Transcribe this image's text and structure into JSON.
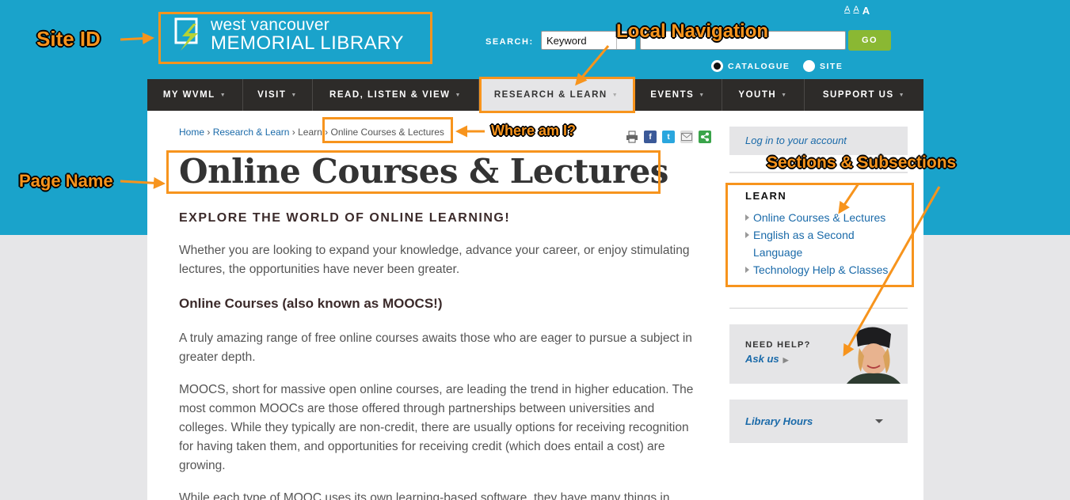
{
  "header": {
    "logo_line1": "west vancouver",
    "logo_line2": "MEMORIAL LIBRARY",
    "text_size": [
      "A",
      "A",
      "A"
    ],
    "search_label": "SEARCH:",
    "search_scope": "Keyword",
    "search_query": "",
    "go_label": "GO",
    "radio_catalogue": "CATALOGUE",
    "radio_site": "SITE"
  },
  "nav": [
    {
      "label": "MY WVML",
      "w": 0
    },
    {
      "label": "VISIT"
    },
    {
      "label": "READ, LISTEN & VIEW"
    },
    {
      "label": "RESEARCH & LEARN"
    },
    {
      "label": "EVENTS"
    },
    {
      "label": "YOUTH"
    },
    {
      "label": "SUPPORT US"
    }
  ],
  "breadcrumb": {
    "home": "Home",
    "sep1": "›",
    "research": "Research & Learn",
    "sep2": "›",
    "learn": "Learn",
    "sep3": "›",
    "current": "Online Courses & Lectures"
  },
  "main": {
    "title": "Online Courses & Lectures",
    "subhead": "EXPLORE THE WORLD OF ONLINE LEARNING!",
    "intro": "Whether you are looking to expand your knowledge, advance your career, or enjoy stimulating lectures, the opportunities have never been greater.",
    "courses_heading": "Online Courses (also known as MOOCS!)",
    "p1": "A truly amazing range of free online courses awaits those who are eager to pursue a subject in greater depth.",
    "p2": "MOOCS, short for massive open online courses, are leading the trend in higher education. The most common MOOCs are those offered through partnerships between universities and colleges. While they typically are non-credit, there are usually options for receiving recognition for having taken them, and opportunities for receiving credit (which does entail a cost) are growing.",
    "p3": "While each type of MOOC uses its own learning-based software, they have many things in"
  },
  "sidebar": {
    "login": "Log in to your account",
    "section_heading": "LEARN",
    "links": [
      "Online Courses & Lectures",
      "English as a Second Language",
      "Technology Help & Classes"
    ],
    "need_help": "NEED HELP?",
    "ask_us": "Ask us",
    "hours": "Library Hours"
  },
  "annotations": {
    "site_id": "Site ID",
    "local_nav": "Local Navigation",
    "where_am_i": "Where am I?",
    "page_name": "Page Name",
    "sections": "Sections & Subsections"
  },
  "colors": {
    "header_blue": "#1aa3cb",
    "nav_dark": "#2d2b29",
    "annotation_orange": "#f7941d",
    "go_green": "#8ab833",
    "link_blue": "#1a6aa9"
  }
}
